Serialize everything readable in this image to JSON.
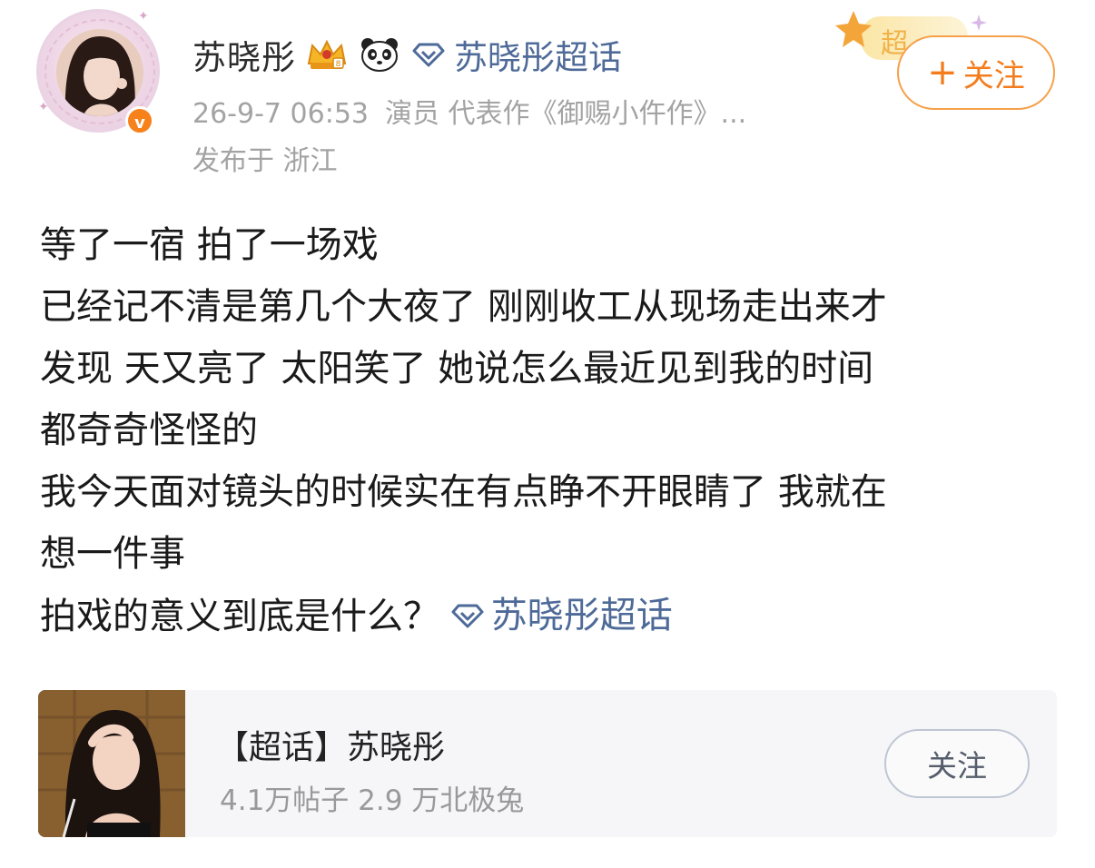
{
  "header": {
    "user_name": "苏晓彤",
    "topic_link": "苏晓彤超话",
    "timestamp": "26-9-7 06:53",
    "bio": "演员 代表作《御赐小仵作》...",
    "location": "发布于 浙江",
    "follow_label": "关注",
    "follow_plus": "+",
    "supertopic_tag": "超"
  },
  "post": {
    "lines": [
      "等了一宿 拍了一场戏",
      "已经记不清是第几个大夜了 刚刚收工从现场走出来才",
      "发现 天又亮了 太阳笑了 她说怎么最近见到我的时间",
      "都奇奇怪怪的",
      "我今天面对镜头的时候实在有点睁不开眼睛了 我就在",
      "想一件事"
    ],
    "last_line_text": "拍戏的意义到底是什么？",
    "last_line_topic": "苏晓彤超话"
  },
  "card": {
    "title": "【超话】苏晓彤",
    "stats": "4.1万帖子  2.9 万北极兔",
    "follow_label": "关注"
  },
  "colors": {
    "accent_orange": "#f47c1c",
    "topic_blue": "#4e6a98",
    "meta_gray": "#a3a3a3"
  }
}
